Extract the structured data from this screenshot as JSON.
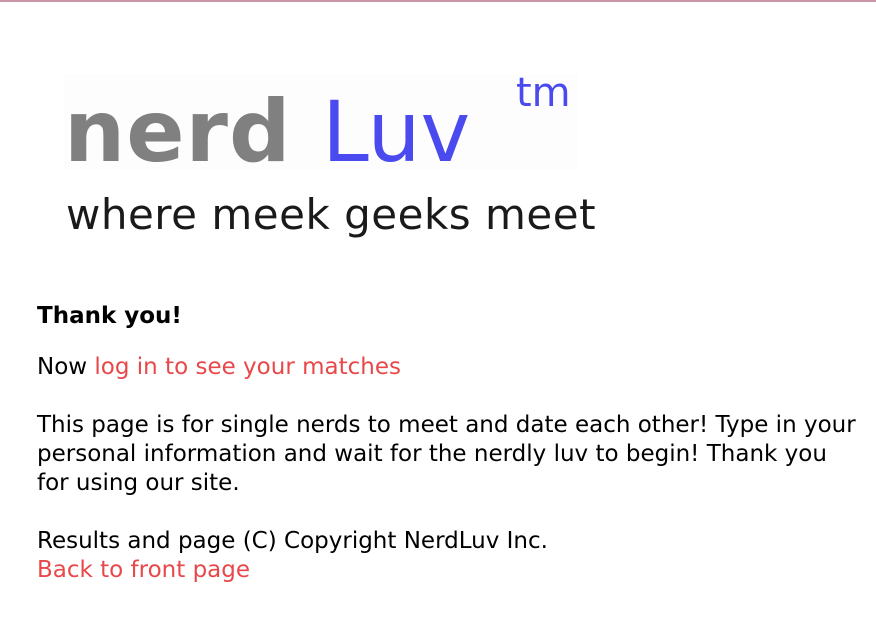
{
  "colors": {
    "top_border": "#c896a8",
    "logo_nerd": "#808080",
    "logo_luv": "#4a4aee",
    "link": "#e8484a"
  },
  "logo": {
    "nerd": "nerd",
    "luv": "Luv",
    "tm": "tm",
    "tagline": "where meek geeks meet"
  },
  "thank_you": "Thank you!",
  "now_line": {
    "prefix": "Now ",
    "link": "log in to see your matches"
  },
  "description": "This page is for single nerds to meet and date each other! Type in your personal information and wait for the nerdly luv to begin! Thank you for using our site.",
  "footer": {
    "copyright": "Results and page (C) Copyright NerdLuv Inc.",
    "back_link": "Back to front page"
  }
}
